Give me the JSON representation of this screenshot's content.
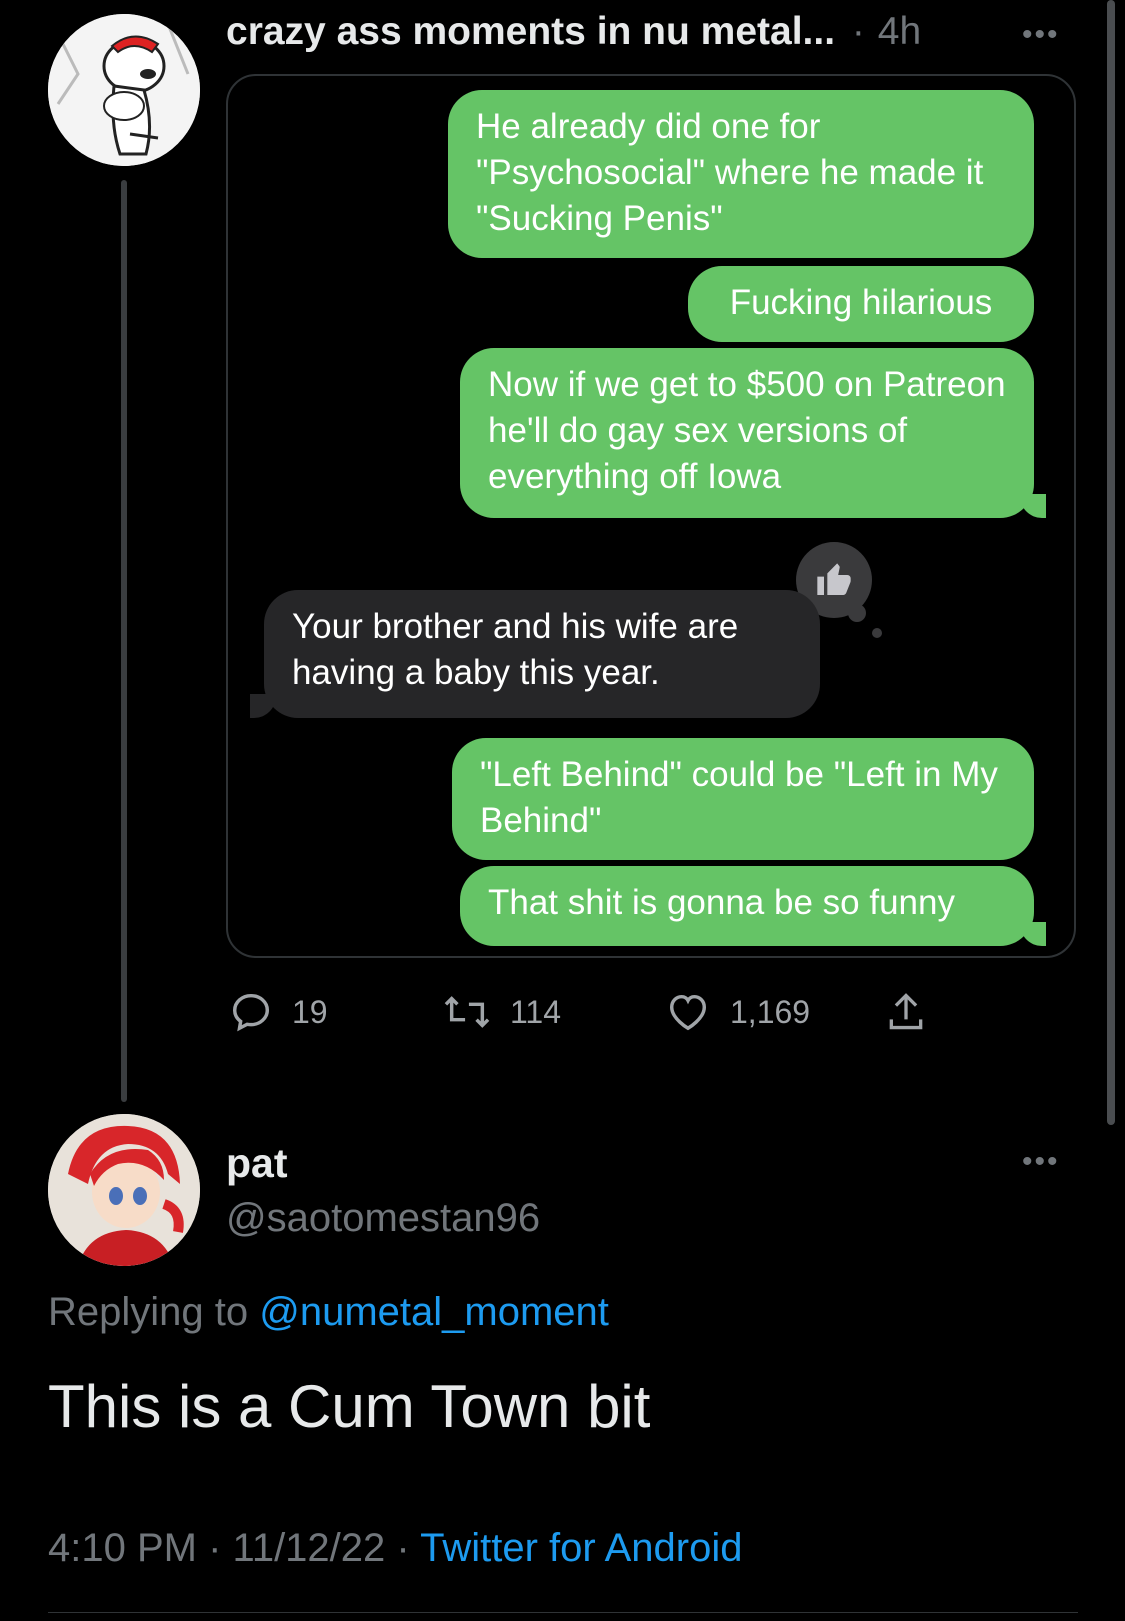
{
  "tweet": {
    "author": "crazy ass moments in nu metal...",
    "separator": "·",
    "time_ago": "4h",
    "more": "•••",
    "media": {
      "messages": [
        {
          "side": "right",
          "text": "He already did one for \"Psychosocial\" where he made it \"Sucking Penis\""
        },
        {
          "side": "right",
          "text": "Fucking hilarious"
        },
        {
          "side": "right",
          "text": "Now if we get to $500 on Patreon he'll do gay sex versions of everything off Iowa"
        },
        {
          "side": "left",
          "text": "Your brother and his wife are having a baby this year."
        },
        {
          "side": "right",
          "text": "\"Left Behind\" could be \"Left in My Behind\""
        },
        {
          "side": "right",
          "text": "That shit is gonna be so funny"
        }
      ],
      "reaction_icon": "thumbs-up-icon"
    },
    "actions": {
      "replies": "19",
      "retweets": "114",
      "likes": "1,169"
    }
  },
  "reply": {
    "name": "pat",
    "handle": "@saotomestan96",
    "more": "•••",
    "replying_prefix": "Replying to",
    "replying_handle": "@numetal_moment",
    "text": "This is a Cum Town bit",
    "time": "4:10 PM",
    "date": "11/12/22",
    "sep": "·",
    "source": "Twitter for Android"
  },
  "colors": {
    "background": "#000000",
    "bubble_green": "#65c466",
    "bubble_gray": "#262628",
    "link_blue": "#1d9bf0",
    "secondary_text": "#71767b"
  }
}
